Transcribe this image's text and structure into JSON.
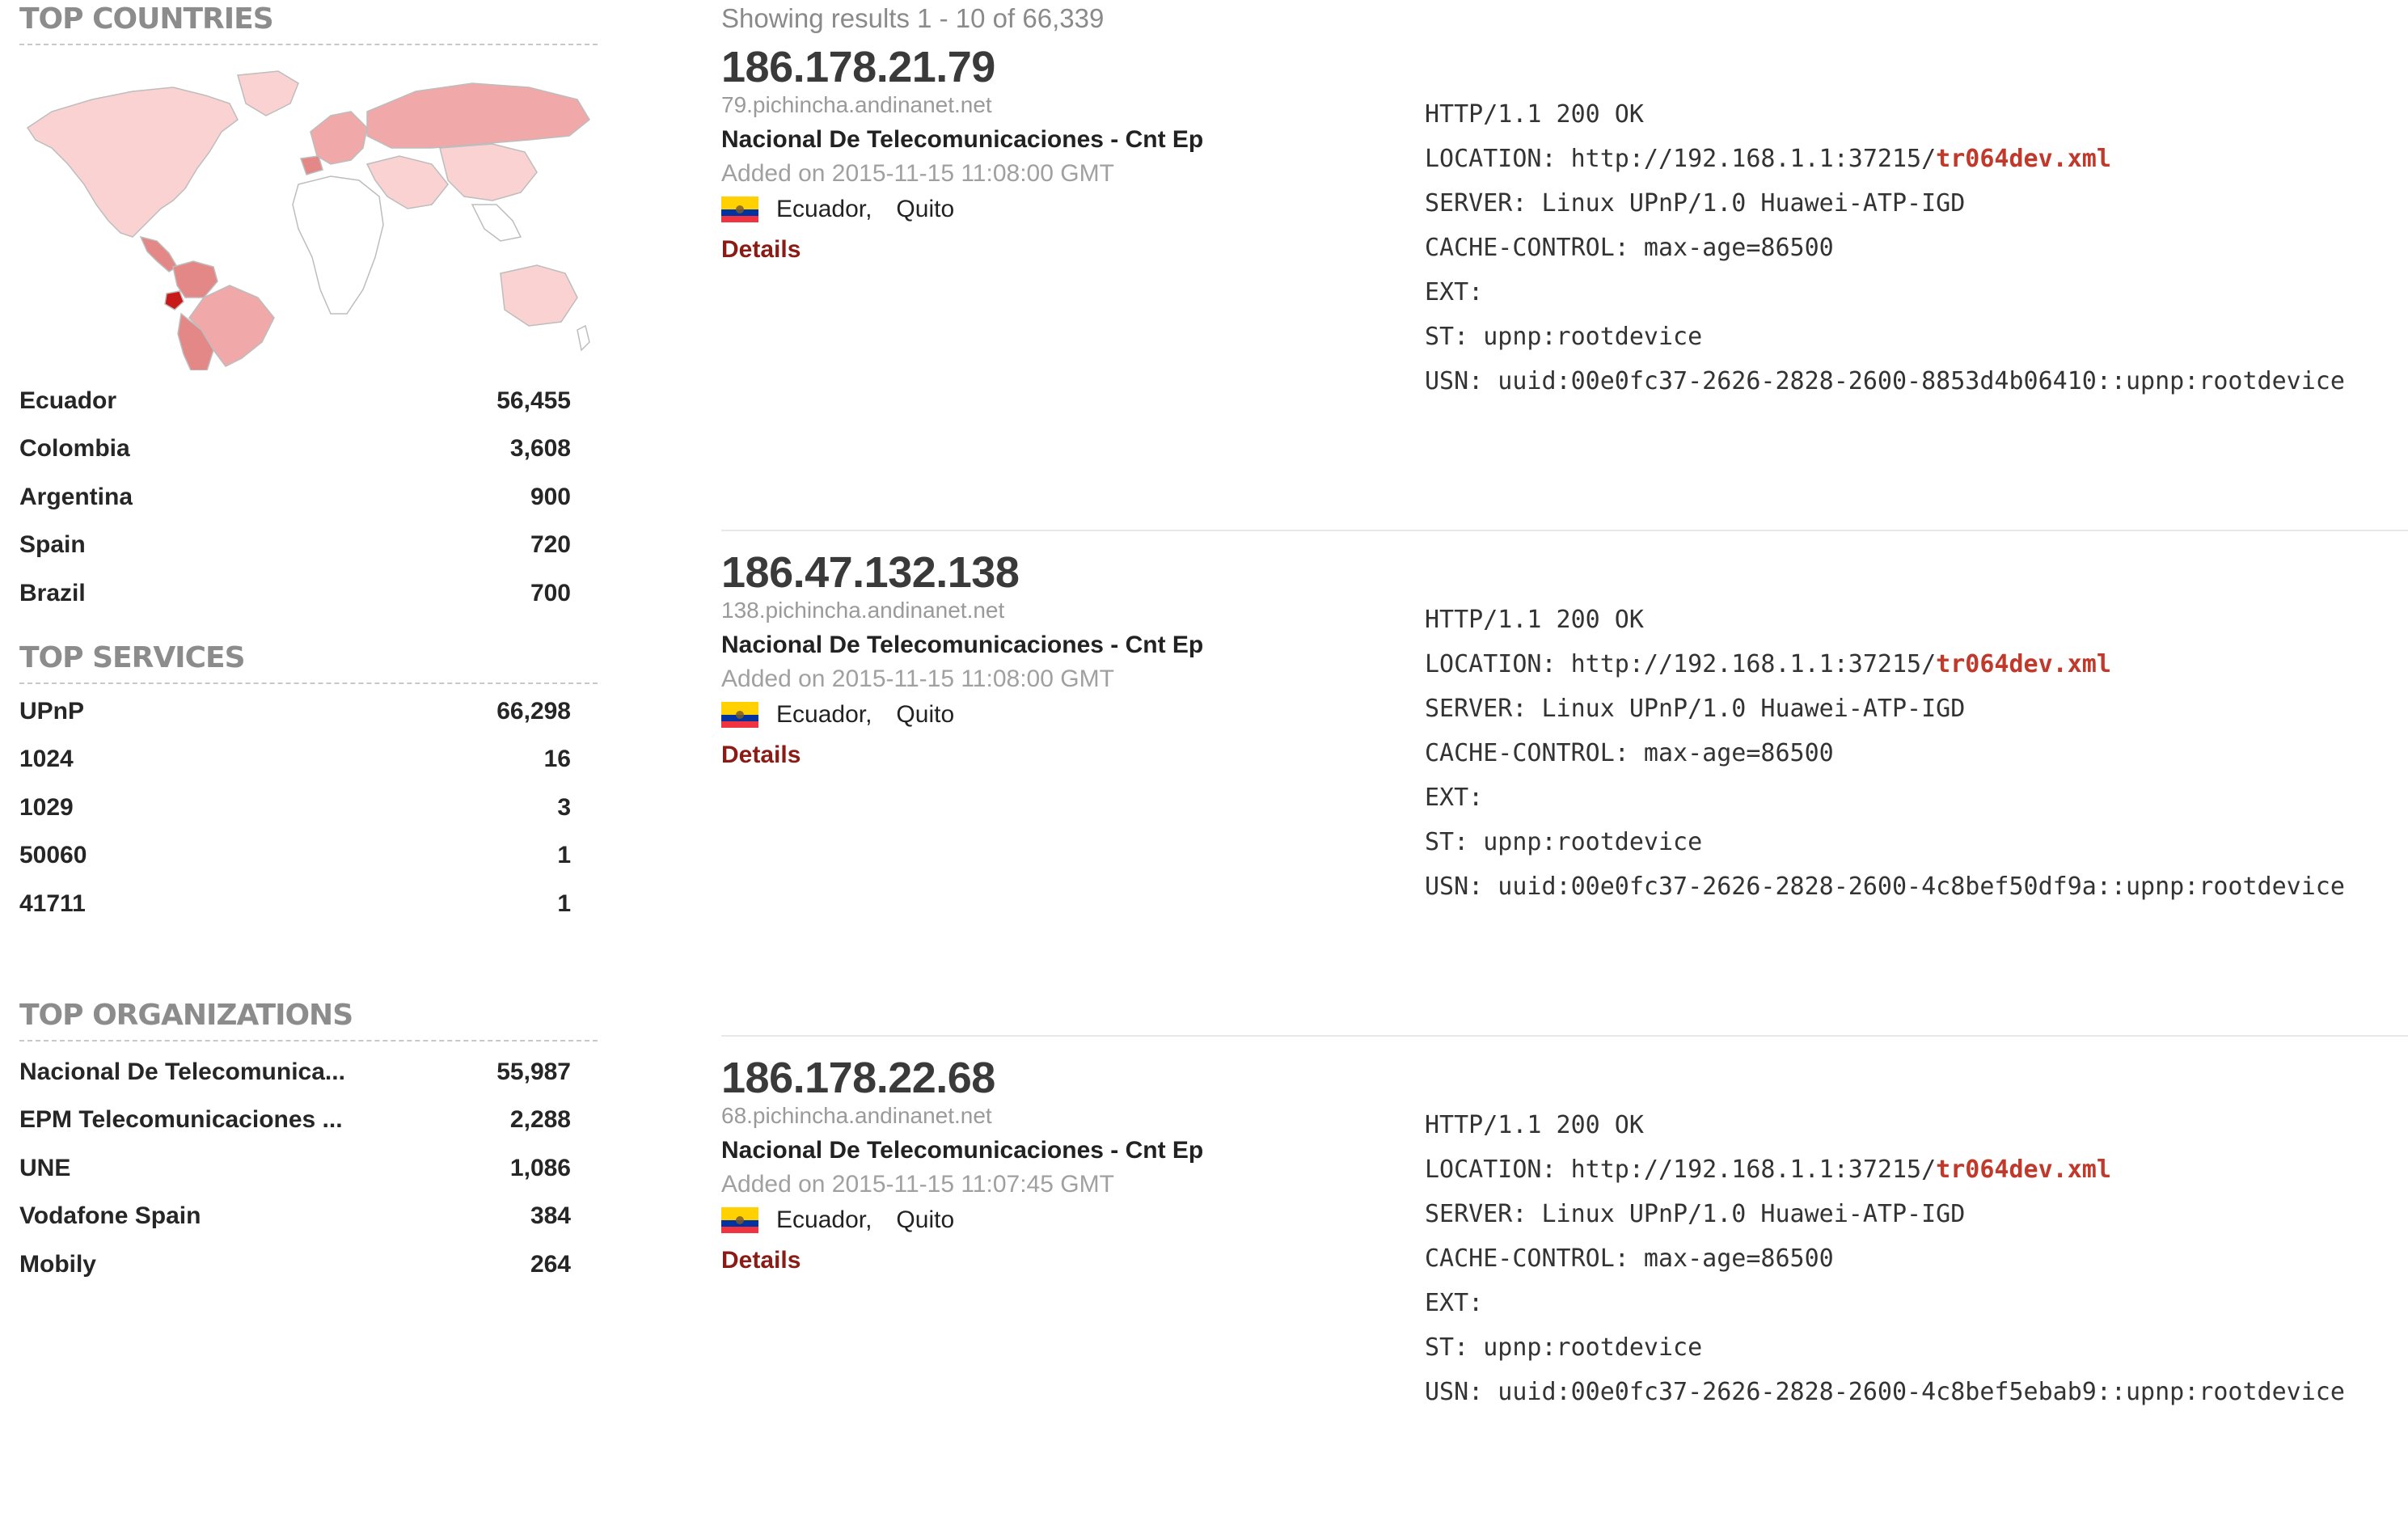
{
  "sidebar": {
    "countries": {
      "title": "TOP COUNTRIES",
      "items": [
        {
          "name": "Ecuador",
          "count": "56,455"
        },
        {
          "name": "Colombia",
          "count": "3,608"
        },
        {
          "name": "Argentina",
          "count": "900"
        },
        {
          "name": "Spain",
          "count": "720"
        },
        {
          "name": "Brazil",
          "count": "700"
        }
      ]
    },
    "services": {
      "title": "TOP SERVICES",
      "items": [
        {
          "name": "UPnP",
          "count": "66,298"
        },
        {
          "name": "1024",
          "count": "16"
        },
        {
          "name": "1029",
          "count": "3"
        },
        {
          "name": "50060",
          "count": "1"
        },
        {
          "name": "41711",
          "count": "1"
        }
      ]
    },
    "organizations": {
      "title": "TOP ORGANIZATIONS",
      "items": [
        {
          "name": "Nacional De Telecomunica...",
          "count": "55,987"
        },
        {
          "name": "EPM Telecomunicaciones ...",
          "count": "2,288"
        },
        {
          "name": "UNE",
          "count": "1,086"
        },
        {
          "name": "Vodafone Spain",
          "count": "384"
        },
        {
          "name": "Mobily",
          "count": "264"
        }
      ]
    }
  },
  "map_colors": {
    "land_default": "#ffffff",
    "light": "#fbd2d2",
    "medium": "#f0a8a8",
    "strong": "#e48787",
    "top": "#c91a1a",
    "border": "#bdbdbd"
  },
  "flag_colors": {
    "yellow": "#ffd100",
    "blue": "#0033a0",
    "red": "#ef3340"
  },
  "results_summary": "Showing results 1 - 10 of 66,339",
  "results": [
    {
      "ip": "186.178.21.79",
      "hostname": "79.pichincha.andinanet.net",
      "org": "Nacional De Telecomunicaciones - Cnt Ep",
      "added": "Added on 2015-11-15 11:08:00 GMT",
      "country": "Ecuador,",
      "city": "Quito",
      "details": "Details",
      "banner": {
        "status": "HTTP/1.1 200 OK",
        "location_prefix": "LOCATION: http://192.168.1.1:37215/",
        "location_file": "tr064dev.xml",
        "server": "SERVER: Linux UPnP/1.0 Huawei-ATP-IGD",
        "cache": "CACHE-CONTROL: max-age=86500",
        "ext": "EXT:",
        "st": "ST: upnp:rootdevice",
        "usn": "USN: uuid:00e0fc37-2626-2828-2600-8853d4b06410::upnp:rootdevice"
      }
    },
    {
      "ip": "186.47.132.138",
      "hostname": "138.pichincha.andinanet.net",
      "org": "Nacional De Telecomunicaciones - Cnt Ep",
      "added": "Added on 2015-11-15 11:08:00 GMT",
      "country": "Ecuador,",
      "city": "Quito",
      "details": "Details",
      "banner": {
        "status": "HTTP/1.1 200 OK",
        "location_prefix": "LOCATION: http://192.168.1.1:37215/",
        "location_file": "tr064dev.xml",
        "server": "SERVER: Linux UPnP/1.0 Huawei-ATP-IGD",
        "cache": "CACHE-CONTROL: max-age=86500",
        "ext": "EXT:",
        "st": "ST: upnp:rootdevice",
        "usn": "USN: uuid:00e0fc37-2626-2828-2600-4c8bef50df9a::upnp:rootdevice"
      }
    },
    {
      "ip": "186.178.22.68",
      "hostname": "68.pichincha.andinanet.net",
      "org": "Nacional De Telecomunicaciones - Cnt Ep",
      "added": "Added on 2015-11-15 11:07:45 GMT",
      "country": "Ecuador,",
      "city": "Quito",
      "details": "Details",
      "banner": {
        "status": "HTTP/1.1 200 OK",
        "location_prefix": "LOCATION: http://192.168.1.1:37215/",
        "location_file": "tr064dev.xml",
        "server": "SERVER: Linux UPnP/1.0 Huawei-ATP-IGD",
        "cache": "CACHE-CONTROL: max-age=86500",
        "ext": "EXT:",
        "st": "ST: upnp:rootdevice",
        "usn": "USN: uuid:00e0fc37-2626-2828-2600-4c8bef5ebab9::upnp:rootdevice"
      }
    }
  ]
}
